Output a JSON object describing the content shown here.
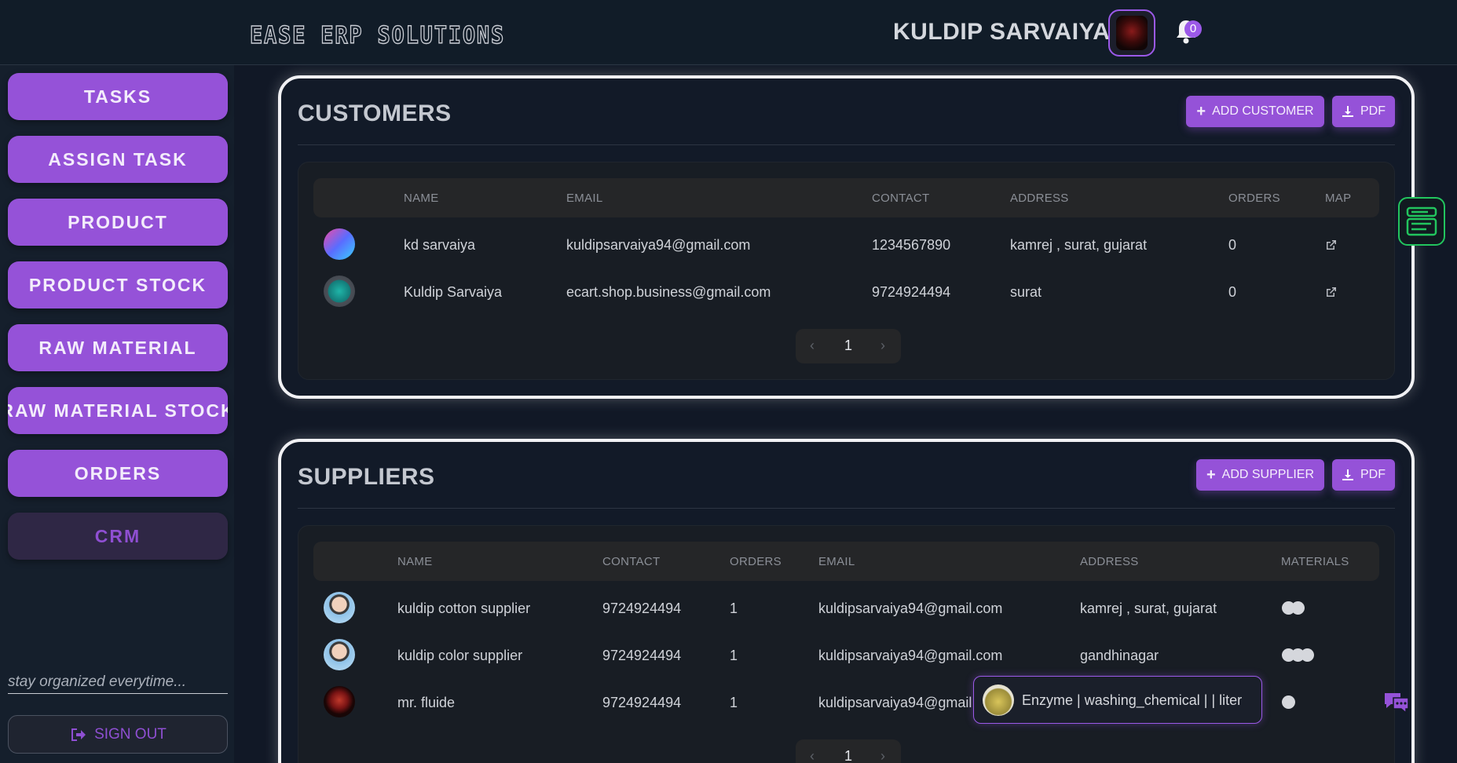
{
  "header": {
    "brand": "EASE ERP SOLUTIONS",
    "user_name": "KULDIP SARVAIYA",
    "notifications_count": "0"
  },
  "sidebar": {
    "items": [
      {
        "label": "TASKS"
      },
      {
        "label": "ASSIGN TASK"
      },
      {
        "label": "PRODUCT"
      },
      {
        "label": "PRODUCT STOCK"
      },
      {
        "label": "RAW MATERIAL"
      },
      {
        "label": "RAW MATERIAL STOCK"
      },
      {
        "label": "ORDERS"
      },
      {
        "label": "CRM"
      }
    ],
    "tagline": "stay organized everytime...",
    "sign_out": "SIGN OUT"
  },
  "customers": {
    "title": "CUSTOMERS",
    "add_label": "ADD CUSTOMER",
    "pdf_label": "PDF",
    "columns": [
      "NAME",
      "EMAIL",
      "CONTACT",
      "ADDRESS",
      "ORDERS",
      "MAP"
    ],
    "rows": [
      {
        "name": "kd sarvaiya",
        "email": "kuldipsarvaiya94@gmail.com",
        "contact": "1234567890",
        "address": "kamrej , surat, gujarat",
        "orders": "0"
      },
      {
        "name": "Kuldip Sarvaiya",
        "email": "ecart.shop.business@gmail.com",
        "contact": "9724924494",
        "address": "surat",
        "orders": "0"
      }
    ],
    "page": "1"
  },
  "suppliers": {
    "title": "SUPPLIERS",
    "add_label": "ADD SUPPLIER",
    "pdf_label": "PDF",
    "columns": [
      "NAME",
      "CONTACT",
      "ORDERS",
      "EMAIL",
      "ADDRESS",
      "MATERIALS"
    ],
    "rows": [
      {
        "name": "kuldip cotton supplier",
        "contact": "9724924494",
        "orders": "1",
        "email": "kuldipsarvaiya94@gmail.com",
        "address": "kamrej , surat, gujarat",
        "materials_count": 2
      },
      {
        "name": "kuldip color supplier",
        "contact": "9724924494",
        "orders": "1",
        "email": "kuldipsarvaiya94@gmail.com",
        "address": "gandhinagar",
        "materials_count": 3
      },
      {
        "name": "mr. fluide",
        "contact": "9724924494",
        "orders": "1",
        "email": "kuldipsarvaiya94@gmail.c",
        "address": "",
        "materials_count": 1
      }
    ],
    "page": "1"
  },
  "tooltip": {
    "text": "Enzyme  | washing_chemical  |     | liter"
  },
  "colors": {
    "accent": "#9552d8",
    "background": "#111826",
    "widget_green": "#22c55e"
  }
}
